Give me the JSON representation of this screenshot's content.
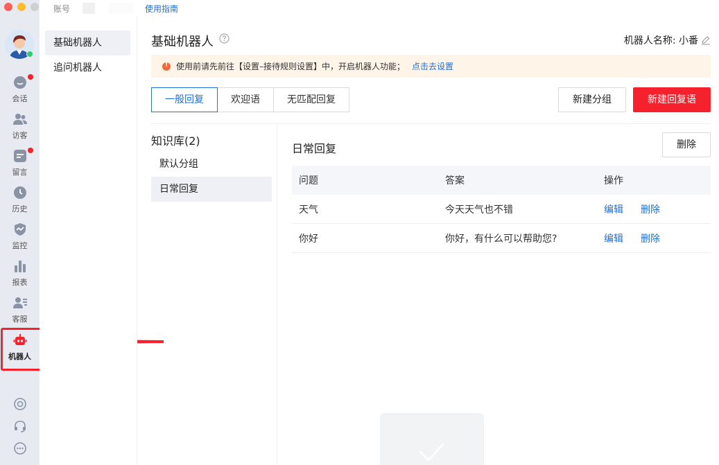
{
  "window": {
    "controls": [
      {
        "name": "close",
        "color": "#fe5f57"
      },
      {
        "name": "minimize",
        "color": "#febc2e"
      },
      {
        "name": "zoom",
        "color": "#d0d0d0"
      }
    ]
  },
  "topbar": {
    "account_label": "账号",
    "guide_link": "使用指南"
  },
  "rail": {
    "items": [
      {
        "label": "会话",
        "icon": "chat-icon",
        "badge": true
      },
      {
        "label": "访客",
        "icon": "visitors-icon",
        "badge": false
      },
      {
        "label": "留言",
        "icon": "message-icon",
        "badge": true
      },
      {
        "label": "历史",
        "icon": "history-icon",
        "badge": false
      },
      {
        "label": "监控",
        "icon": "monitor-icon",
        "badge": false
      },
      {
        "label": "报表",
        "icon": "report-icon",
        "badge": false
      },
      {
        "label": "客服",
        "icon": "agent-icon",
        "badge": false
      },
      {
        "label": "机器人",
        "icon": "robot-icon",
        "badge": false,
        "active": true
      }
    ],
    "accent": "#f5222d"
  },
  "subnav": {
    "items": [
      {
        "label": "基础机器人",
        "active": true
      },
      {
        "label": "追问机器人",
        "active": false
      }
    ]
  },
  "main": {
    "title": "基础机器人",
    "robot_name_label": "机器人名称: 小番",
    "notice": {
      "text": "使用前请先前往【设置–接待规则设置】中，开启机器人功能；",
      "link": "点击去设置"
    },
    "tabs": [
      {
        "label": "一般回复",
        "active": true
      },
      {
        "label": "欢迎语",
        "active": false
      },
      {
        "label": "无匹配回复",
        "active": false
      }
    ],
    "new_group_label": "新建分组",
    "new_reply_label": "新建回复语"
  },
  "knowledge_base": {
    "title": "知识库(2)",
    "groups": [
      {
        "label": "默认分组",
        "active": false
      },
      {
        "label": "日常回复",
        "active": true
      }
    ]
  },
  "detail": {
    "title": "日常回复",
    "delete_label": "删除",
    "columns": [
      "问题",
      "答案",
      "操作"
    ],
    "rows": [
      {
        "question": "天气",
        "answer": "今天天气也不错",
        "edit": "编辑",
        "delete": "删除"
      },
      {
        "question": "你好",
        "answer": "你好，有什么可以帮助您?",
        "edit": "编辑",
        "delete": "删除"
      }
    ]
  },
  "colors": {
    "primary": "#1a6fd8",
    "danger": "#f5222d",
    "rail_bg": "#e8eaf1",
    "notice_bg": "#fef4e8"
  }
}
